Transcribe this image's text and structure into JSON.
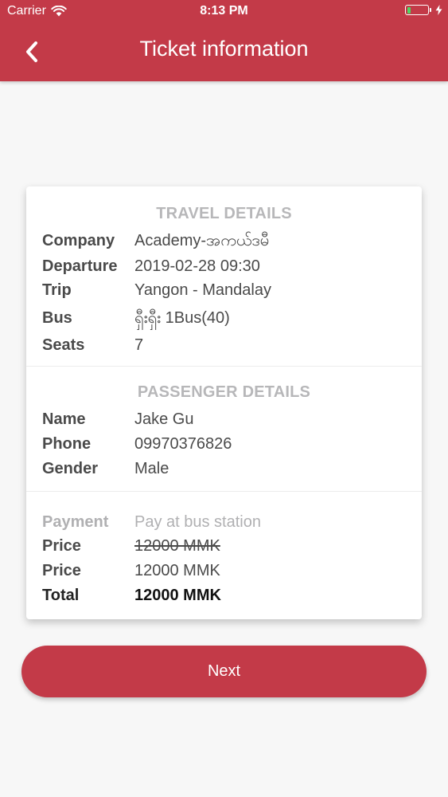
{
  "status_bar": {
    "carrier": "Carrier",
    "time": "8:13 PM",
    "battery_level": 0.2,
    "battery_color": "#4cd964"
  },
  "header": {
    "title": "Ticket information",
    "back_icon": "chevron-left-icon",
    "color": "#c33a48"
  },
  "travel_details": {
    "title": "TRAVEL DETAILS",
    "company": {
      "label": "Company",
      "value": "Academy-အကယ်ဒမီ"
    },
    "departure": {
      "label": "Departure",
      "value": "2019-02-28 09:30"
    },
    "trip": {
      "label": "Trip",
      "value": "Yangon - Mandalay"
    },
    "bus": {
      "label": "Bus",
      "value": "ရှီးရှီး   1Bus(40)"
    },
    "seats": {
      "label": "Seats",
      "value": "7"
    }
  },
  "passenger_details": {
    "title": "PASSENGER DETAILS",
    "name": {
      "label": "Name",
      "value": "Jake Gu"
    },
    "phone": {
      "label": "Phone",
      "value": "09970376826"
    },
    "gender": {
      "label": "Gender",
      "value": "Male"
    }
  },
  "payment": {
    "method": {
      "label": "Payment",
      "value": "Pay at bus station"
    },
    "original_price": {
      "label": "Price",
      "value": "12000 MMK"
    },
    "price": {
      "label": "Price",
      "value": "12000 MMK"
    },
    "total": {
      "label": "Total",
      "value": "12000 MMK"
    }
  },
  "next_button": {
    "label": "Next"
  }
}
